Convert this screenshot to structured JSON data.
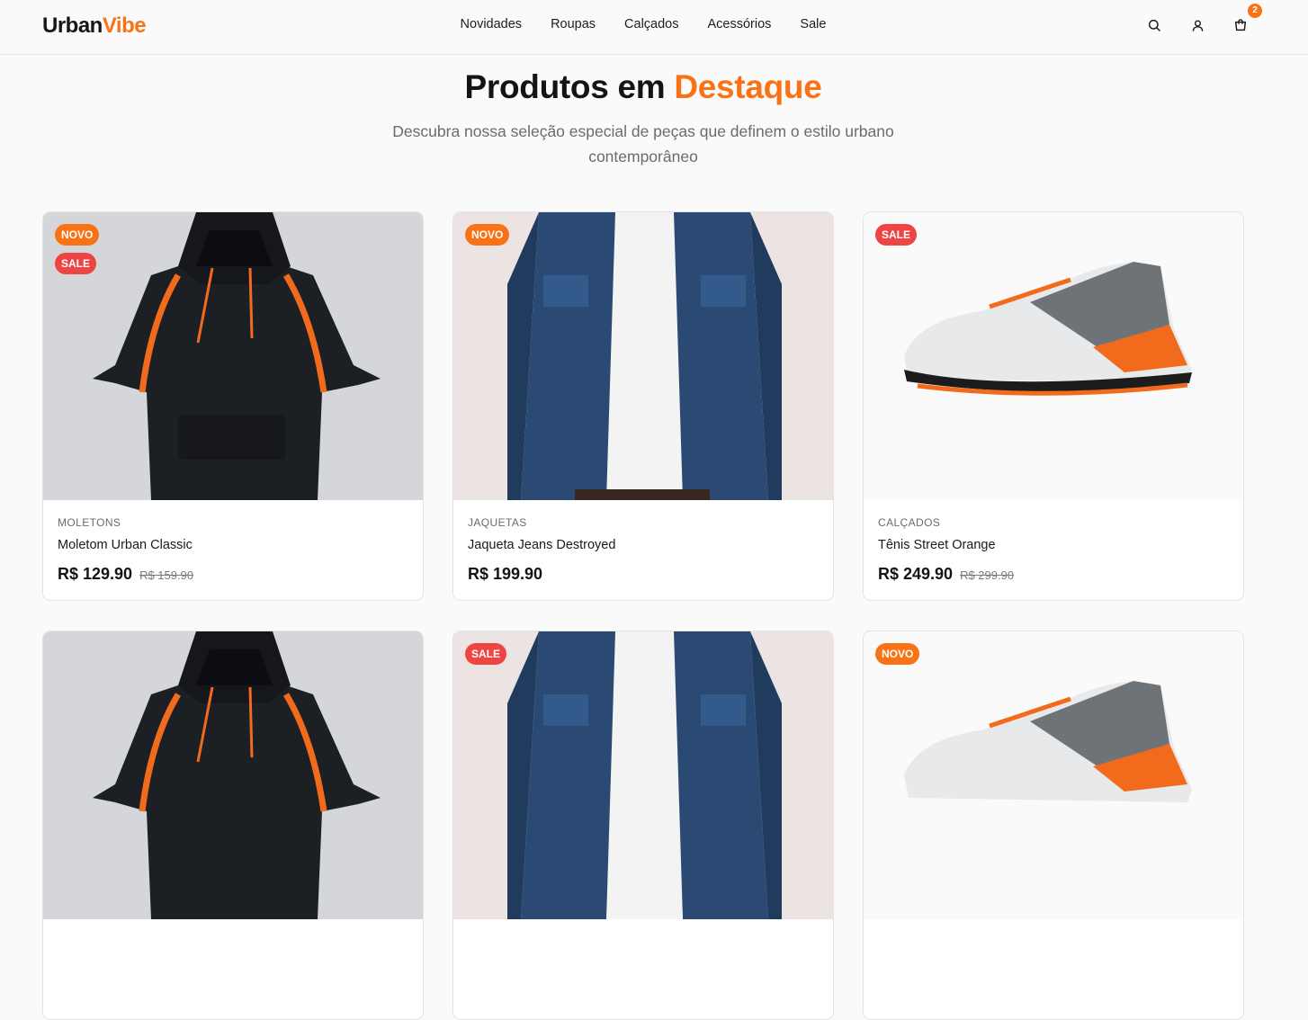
{
  "brand": {
    "part1": "Urban",
    "part2": "Vibe"
  },
  "nav": [
    "Novidades",
    "Roupas",
    "Calçados",
    "Acessórios",
    "Sale"
  ],
  "header_icons": [
    "search-icon",
    "user-icon",
    "cart-icon"
  ],
  "cart": {
    "count": "2"
  },
  "hero": {
    "title_part1": "Produtos em",
    "title_part2": "Destaque",
    "subtitle": "Descubra nossa seleção especial de peças que definem o estilo urbano contemporâneo"
  },
  "colors": {
    "accent": "#f97316",
    "sale": "#ef4444"
  },
  "products": [
    {
      "category": "MOLETONS",
      "name": "Moletom Urban Classic",
      "price": "R$ 129.90",
      "old_price": "R$ 159.90",
      "tags": [
        "NOVO",
        "SALE"
      ]
    },
    {
      "category": "JAQUETAS",
      "name": "Jaqueta Jeans Destroyed",
      "price": "R$ 199.90",
      "old_price": "",
      "tags": [
        "NOVO"
      ]
    },
    {
      "category": "CALÇADOS",
      "name": "Tênis Street Orange",
      "price": "R$ 249.90",
      "old_price": "R$ 299.90",
      "tags": [
        "SALE"
      ]
    },
    {
      "category": "",
      "name": "",
      "price": "",
      "old_price": "",
      "tags": []
    },
    {
      "category": "",
      "name": "",
      "price": "",
      "old_price": "",
      "tags": [
        "SALE"
      ]
    },
    {
      "category": "",
      "name": "",
      "price": "",
      "old_price": "",
      "tags": [
        "NOVO"
      ]
    }
  ]
}
